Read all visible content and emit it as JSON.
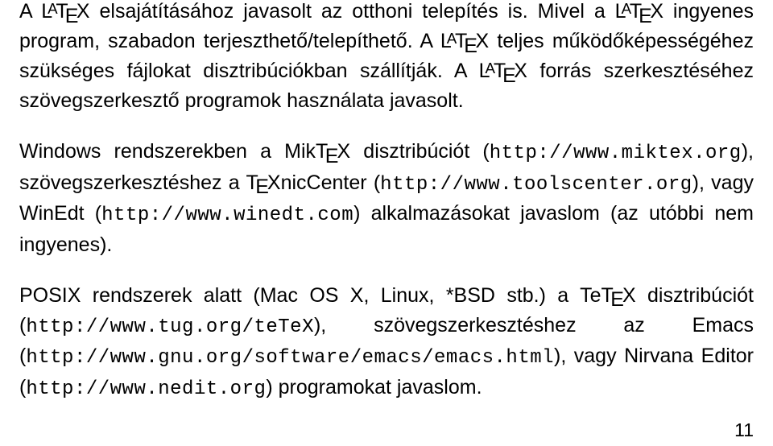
{
  "latex_logo": {
    "L": "L",
    "A": "A",
    "T": "T",
    "E": "E",
    "X": "X"
  },
  "tex_logo": {
    "T": "T",
    "E": "E",
    "X": "X"
  },
  "p1": {
    "t1": "A ",
    "t2": " elsajátításához javasolt az otthoni telepítés is.  Mivel a ",
    "t3": " ingyenes program, szabadon terjeszthető/telepíthető.  A ",
    "t4": " teljes működőképességéhez szükséges fájlokat disztribúciókban szállítják.  A ",
    "t5": " forrás szerkesztéséhez szövegszerkesztő programok használata javasolt."
  },
  "p2": {
    "t1": "Windows rendszerekben a MikT",
    "t1b": "X disztribúciót (",
    "u1": "http://www.miktex.org",
    "t2": "), szövegszerkesztéshez a T",
    "t2b": "XnicCenter (",
    "u2": "http://www.toolscenter.org",
    "t3": "), vagy WinEdt (",
    "u3": "http://www.winedt.com",
    "t4": ") alkalmazásokat javaslom (az utóbbi nem ingyenes)."
  },
  "p3": {
    "t1": "POSIX rendszerek alatt (Mac OS X, Linux, *BSD stb.)  a TeT",
    "t1b": "X disztribúciót (",
    "u1": "http://www.tug.org/teTeX",
    "t2": "), szövegszerkesztéshez az Emacs (",
    "u2": "http://www.gnu.org/software/emacs/emacs.html",
    "t3": "), vagy Nirvana Editor (",
    "u3": "http://www.nedit.org",
    "t4": ") programokat javaslom."
  },
  "page_number": "11"
}
